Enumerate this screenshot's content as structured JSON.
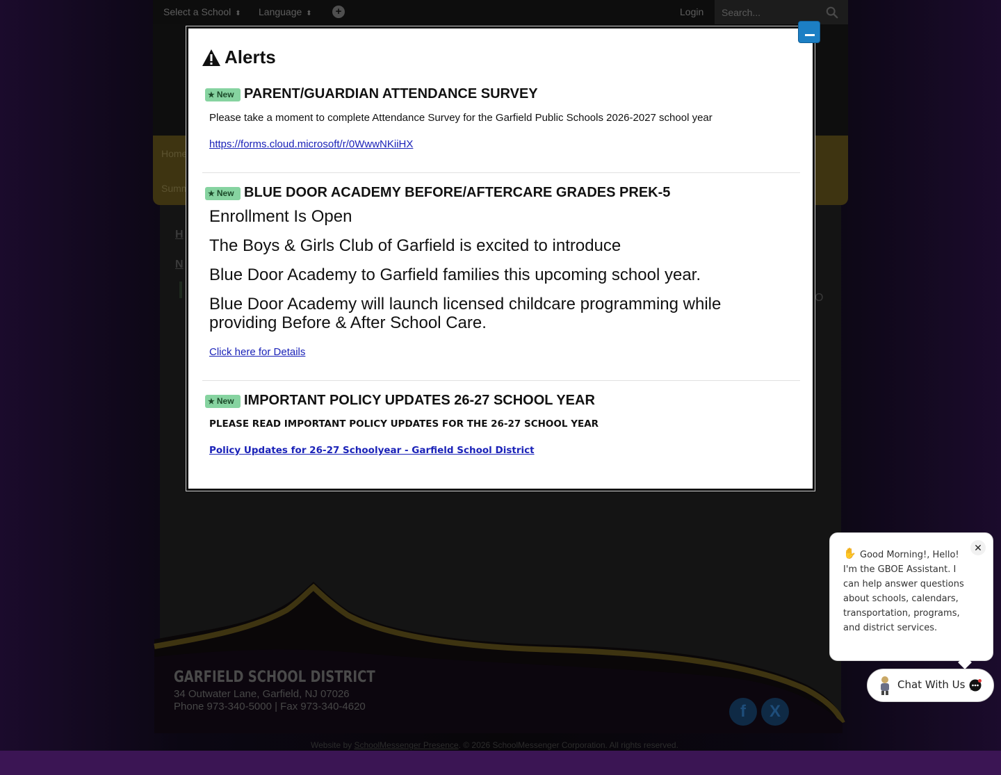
{
  "topbar": {
    "select_school": "Select a School",
    "language": "Language",
    "login": "Login",
    "search_placeholder": "Search..."
  },
  "nav": {
    "home": "Home",
    "summer": "Summ"
  },
  "breadcrumbs": {
    "first": "H",
    "second": "N",
    "stray": "O"
  },
  "alerts": {
    "title": "Alerts",
    "badge": "New",
    "items": [
      {
        "title": "PARENT/GUARDIAN ATTENDANCE SURVEY",
        "text": "Please take a moment to complete Attendance Survey for the Garfield Public Schools 2026-2027 school year",
        "link": "https://forms.cloud.microsoft/r/0WwwNKiiHX"
      },
      {
        "title": "BLUE DOOR ACADEMY BEFORE/AFTERCARE GRADES PREK-5",
        "lines": [
          "Enrollment Is Open",
          "The Boys & Girls Club of Garfield is excited to introduce",
          "Blue Door Academy to Garfield families this upcoming school year.",
          "Blue Door Academy will launch licensed childcare programming while providing Before & After School Care."
        ],
        "link": "Click here for Details"
      },
      {
        "title": "IMPORTANT POLICY UPDATES 26-27 SCHOOL YEAR",
        "text": "PLEASE READ IMPORTANT POLICY UPDATES FOR THE 26-27 SCHOOL YEAR",
        "link": "Policy Updates for 26-27 Schoolyear - Garfield School District"
      }
    ]
  },
  "footer": {
    "district": "GARFIELD SCHOOL DISTRICT",
    "address": "34 Outwater Lane, Garfield, NJ 07026",
    "phone": "Phone 973-340-5000 | Fax 973-340-4620",
    "credit_prefix": "Website by",
    "credit_link": "SchoolMessenger Presence",
    "credit_suffix": ". © 2026 SchoolMessenger Corporation. All rights reserved."
  },
  "chat": {
    "message": "Good Morning!, Hello! I'm the GBOE Assistant. I can help answer questions about schools, calendars, transportation, programs, and district services.",
    "button_label": "Chat With Us",
    "close_glyph": "✕"
  },
  "icons": [
    "search-icon",
    "add-circle-icon",
    "warning-icon",
    "star-icon",
    "facebook-icon",
    "x-icon",
    "wave-icon",
    "chat-icon",
    "minimize-icon"
  ],
  "colors": {
    "accent_gold": "#d9b521",
    "modal_button": "#1c7fc4",
    "new_badge": "#86d3a0",
    "link": "#1a22b8",
    "footer_purple": "#3b1554"
  }
}
